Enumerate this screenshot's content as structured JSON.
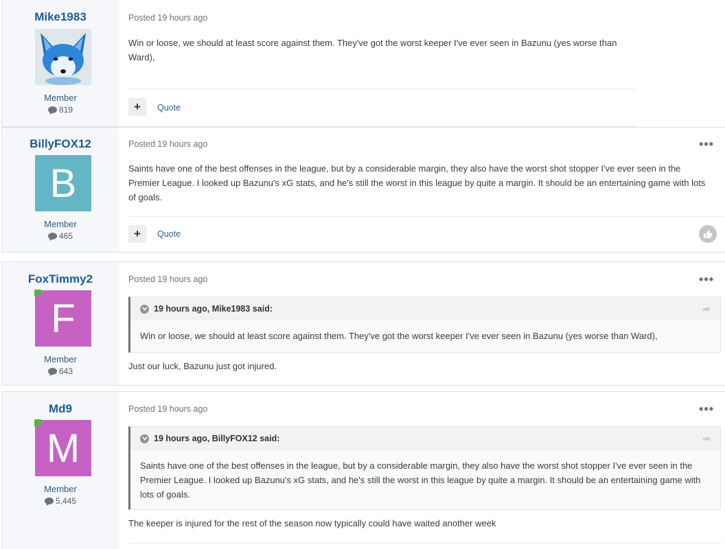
{
  "posts": [
    {
      "author": "Mike1983",
      "member_title": "Member",
      "post_count": "819",
      "posted_label": "Posted",
      "date": "19 hours ago",
      "content": "Win or loose, we should at least score against them. They've got the worst keeper I've ever seen in Bazunu (yes worse than Ward),",
      "actions": {
        "plus": "+",
        "quote": "Quote"
      }
    },
    {
      "author": "BillyFOX12",
      "avatar_letter": "B",
      "avatar_color": "#63b6c6",
      "member_title": "Member",
      "post_count": "465",
      "posted_label": "Posted",
      "date": "19 hours ago",
      "menu": "•••",
      "content": "Saints have one of the best offenses in the league, but by a considerable margin, they also have the worst shot stopper I've ever seen in the Premier League. I looked up Bazunu's xG stats, and he's still the worst in this league by quite a margin. It should be an entertaining game with lots of goals.",
      "actions": {
        "plus": "+",
        "quote": "Quote"
      }
    },
    {
      "author": "FoxTimmy2",
      "avatar_letter": "F",
      "avatar_color": "#c662c3",
      "online": true,
      "member_title": "Member",
      "post_count": "643",
      "posted_label": "Posted",
      "date": "19 hours ago",
      "menu": "•••",
      "quote_header": "19 hours ago, Mike1983 said:",
      "quote_text": "Win or loose, we should at least score against them. They've got the worst keeper I've ever seen in Bazunu (yes worse than Ward),",
      "content": "Just our luck, Bazunu just got injured."
    },
    {
      "author": "Md9",
      "avatar_letter": "M",
      "avatar_color": "#c662c3",
      "online": true,
      "member_title": "Member",
      "post_count": "5,445",
      "posted_label": "Posted",
      "date": "19 hours ago",
      "menu": "•••",
      "quote_header": "19 hours ago, BillyFOX12 said:",
      "quote_text": "Saints have one of the best offenses in the league, but by a considerable margin, they also have the worst shot stopper I've ever seen in the Premier League. I looked up Bazunu's xG stats, and he's still the worst in this league by quite a margin. It should be an entertaining game with lots of goals.",
      "content": "The keeper is injured for the rest of the season now typically could have waited another week"
    }
  ]
}
